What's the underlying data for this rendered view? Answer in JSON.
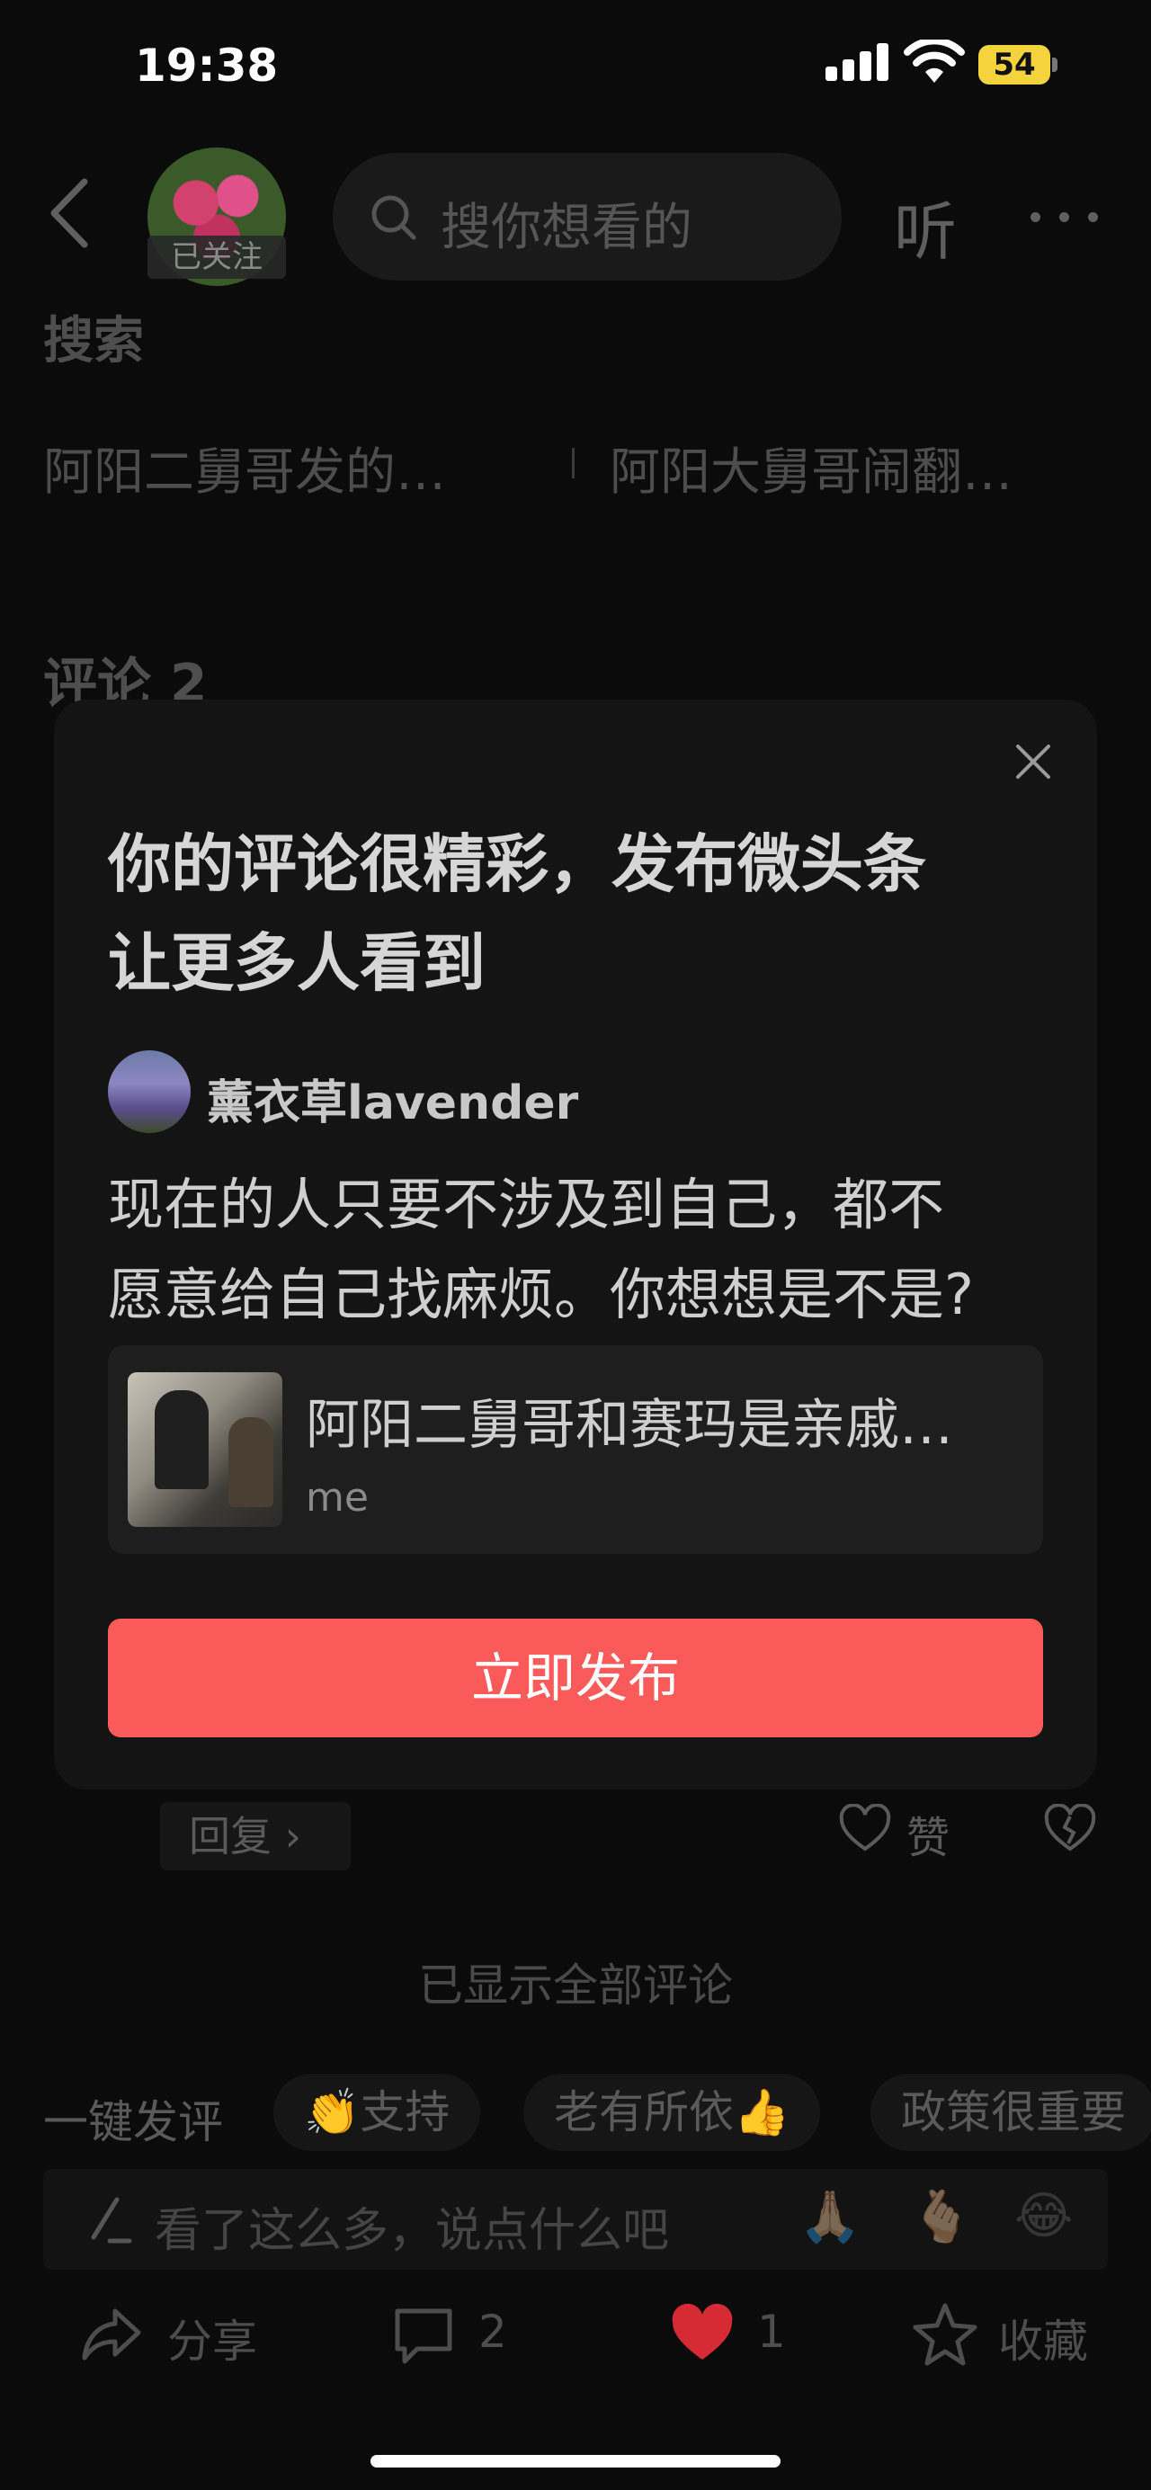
{
  "status_bar": {
    "time": "19:38",
    "battery": "54"
  },
  "header": {
    "followed_badge": "已关注",
    "search_placeholder": "搜你想看的",
    "listen_label": "听"
  },
  "search_section": {
    "label": "搜索",
    "related": [
      "阿阳二舅哥发的…",
      "阿阳大舅哥闹翻…"
    ]
  },
  "comments_title": "评论 2",
  "modal": {
    "title_line1": "你的评论很精彩，发布微头条",
    "title_line2": "让更多人看到",
    "author": "薰衣草lavender",
    "comment_line1": "现在的人只要不涉及到自己，都不",
    "comment_line2": "愿意给自己找麻烦。你想想是不是?",
    "card_title": "阿阳二舅哥和赛玛是亲戚…",
    "card_sub": "me",
    "publish_label": "立即发布"
  },
  "comment_actions": {
    "reply_label": "回复",
    "like_label": "赞"
  },
  "all_shown": "已显示全部评论",
  "quick_comment": {
    "label": "一键发评",
    "chips": [
      "👏支持",
      "老有所依👍",
      "政策很重要"
    ]
  },
  "input": {
    "placeholder": "看了这么多，说点什么吧",
    "emojis": [
      "🙏🏼",
      "🫰🏼",
      "😂"
    ]
  },
  "bottom_bar": {
    "share": "分享",
    "comments": "2",
    "likes": "1",
    "collect": "收藏"
  },
  "colors": {
    "accent": "#fa5a5a",
    "like_red": "#e0303a",
    "battery": "#f4d33c"
  }
}
